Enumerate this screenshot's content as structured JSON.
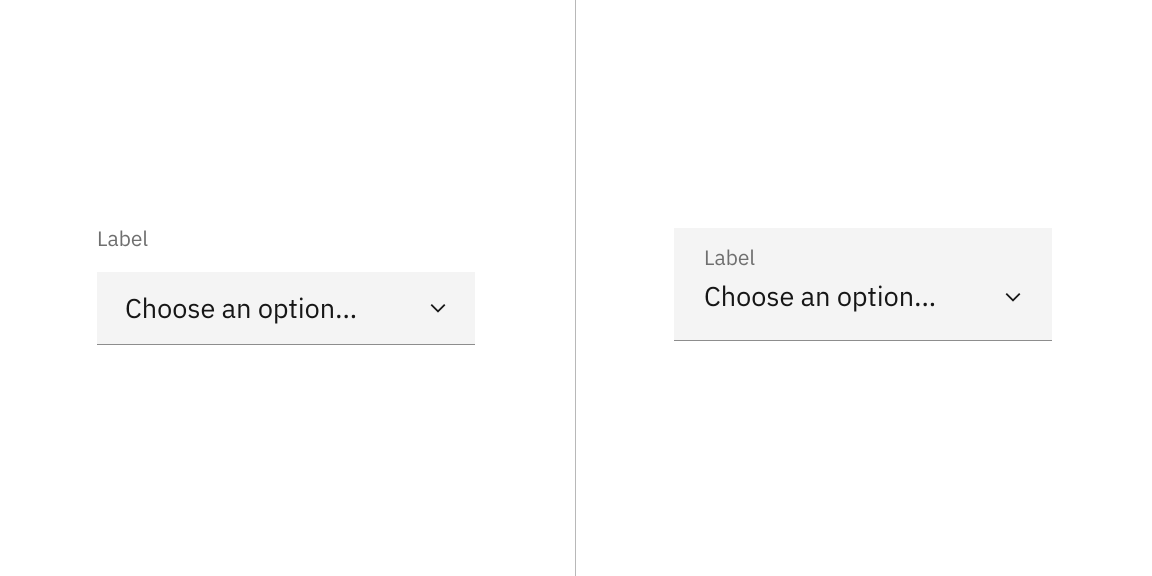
{
  "left": {
    "label": "Label",
    "value": "Choose an option..."
  },
  "right": {
    "label": "Label",
    "value": "Choose an option..."
  }
}
